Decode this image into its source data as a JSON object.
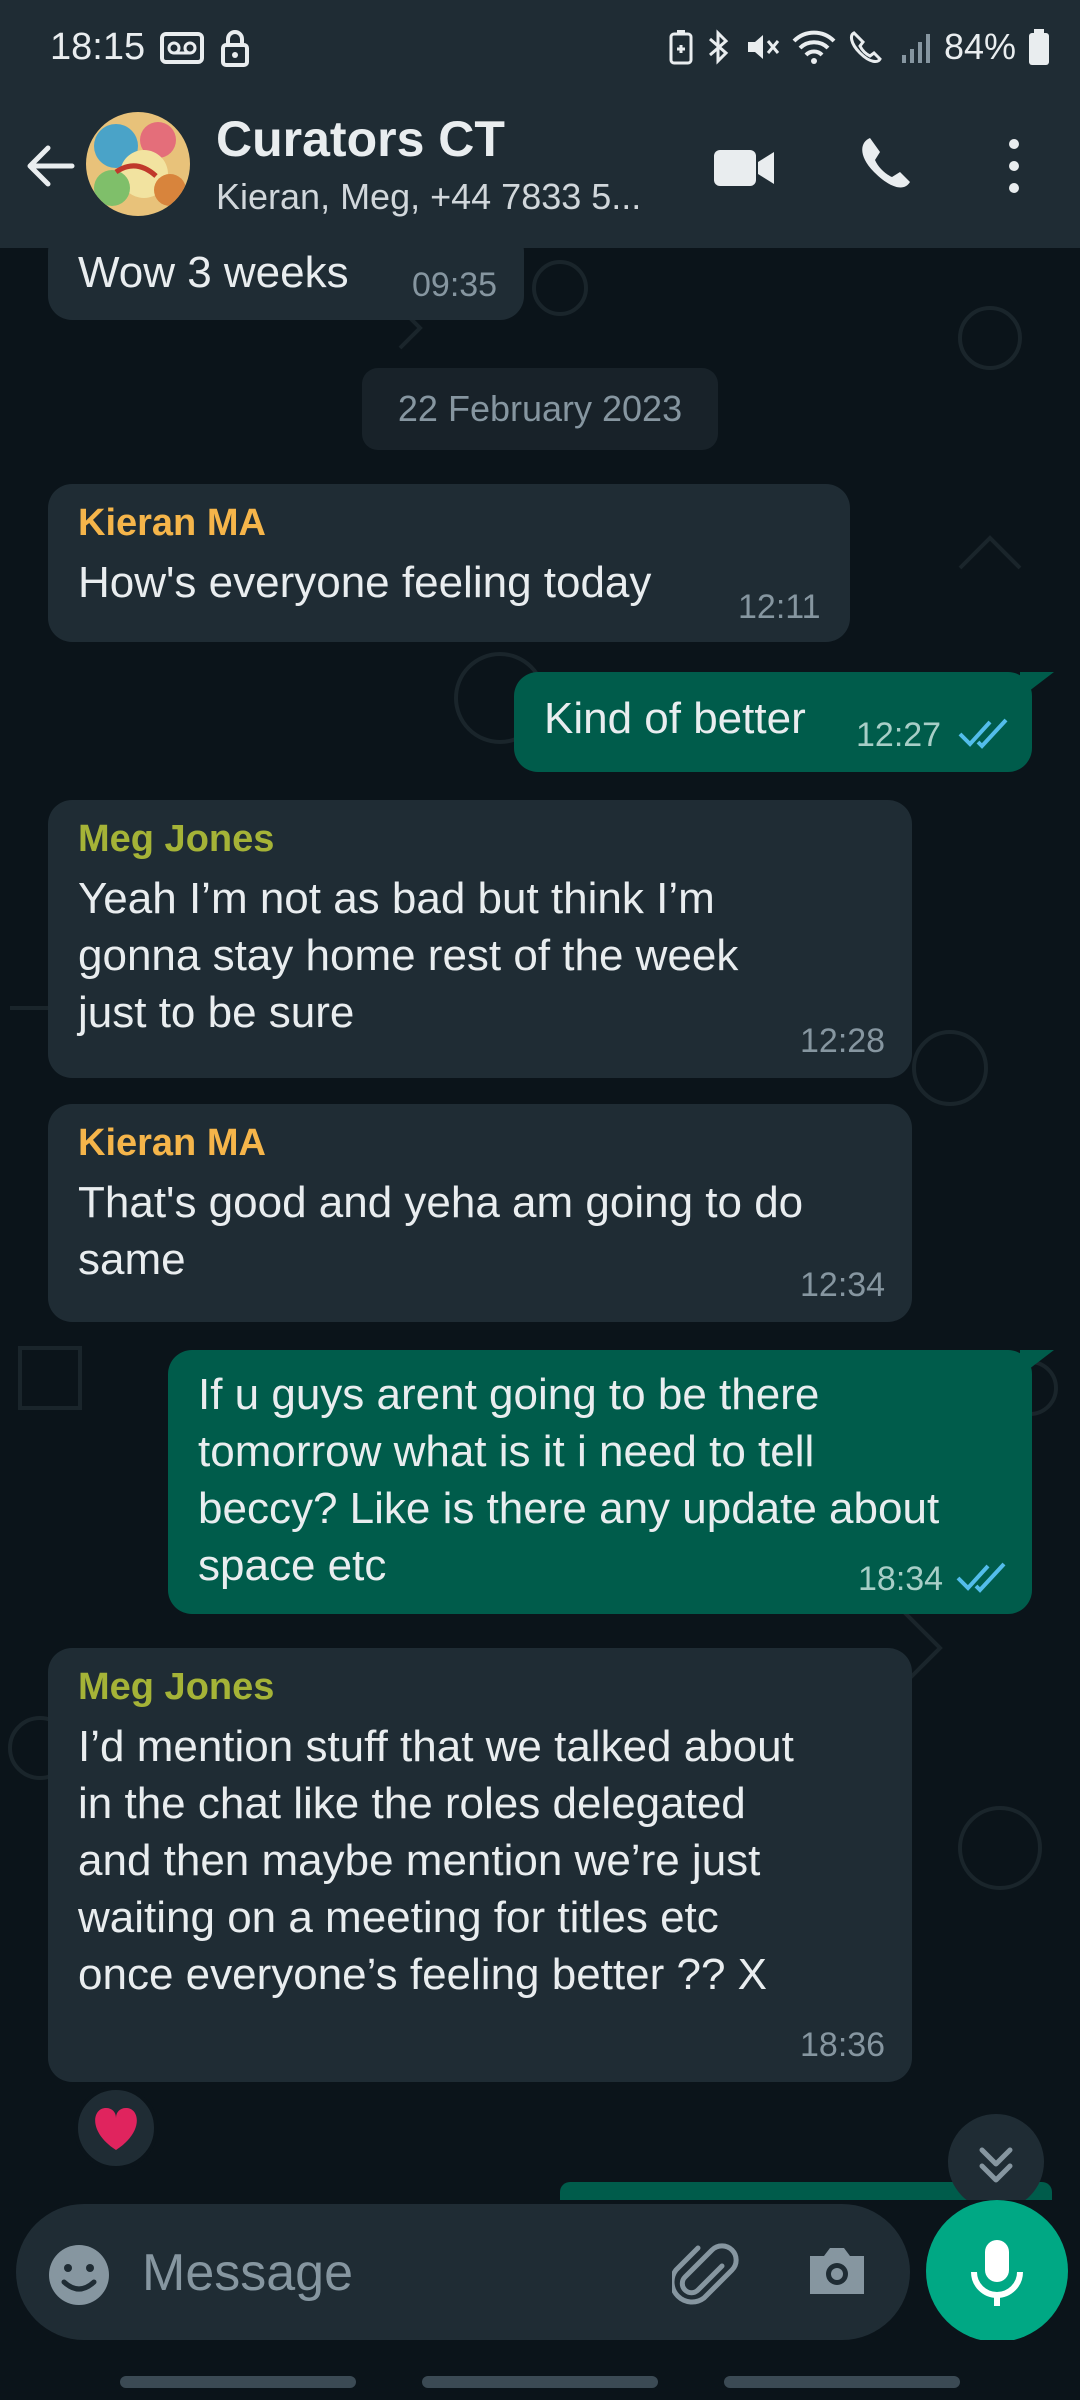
{
  "status_bar": {
    "time": "18:15",
    "battery": "84%",
    "left_icons": [
      "voicemail-icon",
      "lock-icon"
    ],
    "right_icons": [
      "battery-saver-icon",
      "bluetooth-icon",
      "mute-icon",
      "wifi-icon",
      "wifi-call-icon",
      "signal-icon",
      "battery-icon"
    ]
  },
  "header": {
    "title": "Curators CT",
    "members": "Kieran, Meg, +44 7833 5...",
    "actions": [
      "video-call-icon",
      "phone-icon",
      "more-vert-icon"
    ]
  },
  "colors": {
    "accent": "#00a884",
    "outgoing_bubble": "#005c4b",
    "incoming_bubble": "#1f2c34",
    "sender_kieran": "#f5b54a",
    "sender_meg": "#a5b337",
    "read_ticks": "#53bdeb"
  },
  "messages": [
    {
      "direction": "in",
      "sender": "",
      "text": "Wow 3 weeks",
      "time": "09:35"
    },
    {
      "type": "date",
      "text": "22 February 2023"
    },
    {
      "direction": "in",
      "sender": "Kieran MA",
      "text": "How's everyone feeling today",
      "time": "12:11"
    },
    {
      "direction": "out",
      "text": "Kind of better",
      "time": "12:27",
      "status": "read"
    },
    {
      "direction": "in",
      "sender": "Meg Jones",
      "text": "Yeah I’m not as bad but think I’m\ngonna stay home rest of the week\njust to be sure",
      "time": "12:28"
    },
    {
      "direction": "in",
      "sender": "Kieran MA",
      "text": "That's good and yeha am going to do\nsame",
      "time": "12:34"
    },
    {
      "direction": "out",
      "text": "If u guys arent going to be there\ntomorrow what is it i need to tell\nbeccy? Like is there any update about\nspace etc",
      "time": "18:34",
      "status": "read"
    },
    {
      "direction": "in",
      "sender": "Meg Jones",
      "text": "I’d mention stuff that we talked about\nin the chat like the roles delegated\nand then maybe mention we’re just\nwaiting on a meeting for titles etc\nonce everyone’s feeling better ?? X",
      "time": "18:36",
      "reaction": "❤️"
    }
  ],
  "input": {
    "placeholder": "Message",
    "icons": [
      "emoji-icon",
      "attach-icon",
      "camera-icon",
      "mic-icon"
    ]
  }
}
